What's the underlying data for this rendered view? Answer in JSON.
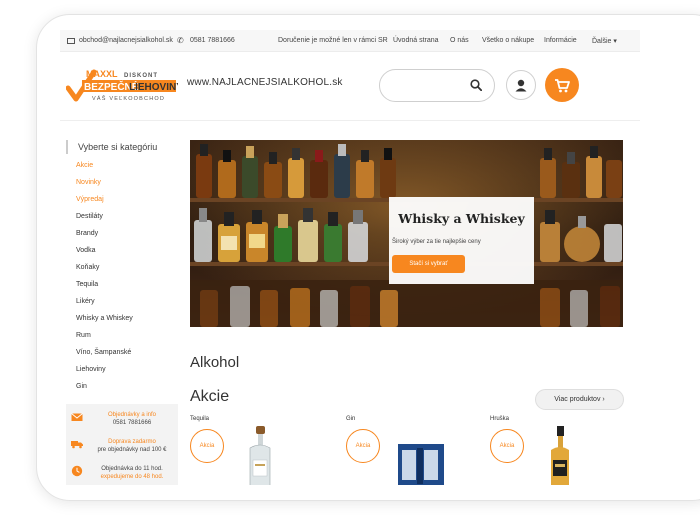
{
  "topbar": {
    "email": "obchod@najlacnejsialkohol.sk",
    "phone": "0581 7881666",
    "links": [
      "Doručenie je možné len v rámci SR",
      "Úvodná strana",
      "O nás",
      "Všetko o nákupe",
      "Informácie",
      "Ďalšie"
    ]
  },
  "logo": {
    "maxxl": "MAXXL",
    "diskont": "DISKONT",
    "bezpecne": "BEZPEČNÉ",
    "liehoviny": "LIEHOVINY",
    "tagline": "VÁŠ VEĽKOOBCHOD"
  },
  "header": {
    "domain": "www.NAJLACNEJSIALKOHOL.sk",
    "search_placeholder": ""
  },
  "sidebar": {
    "title": "Vyberte si kategóriu",
    "items": [
      {
        "label": "Akcie"
      },
      {
        "label": "Novinky"
      },
      {
        "label": "Výpredaj"
      },
      {
        "label": "Destiláty"
      },
      {
        "label": "Brandy"
      },
      {
        "label": "Vodka"
      },
      {
        "label": "Koňaky"
      },
      {
        "label": "Tequila"
      },
      {
        "label": "Likéry"
      },
      {
        "label": "Whisky a Whiskey"
      },
      {
        "label": "Rum"
      },
      {
        "label": "Víno, Šampanské"
      },
      {
        "label": "Liehoviny"
      },
      {
        "label": "Gin"
      }
    ]
  },
  "info": {
    "orders_line1": "Objednávky a info",
    "orders_line2": "0581 7881666",
    "shipping_line1": "Doprava zadarmo",
    "shipping_line2": "pre objednávky nad 100 €",
    "time_line1": "Objednávka do 11 hod.",
    "time_line2": "expedujeme do 48 hod."
  },
  "banner": {
    "title": "Whisky a Whiskey",
    "subtitle": "Široký výber za tie najlepšie ceny",
    "button": "Stačí si vybrať"
  },
  "main": {
    "section_title": "Alkohol",
    "akcie_title": "Akcie",
    "more_button": "Viac produktov ›"
  },
  "products": [
    {
      "category": "Tequila",
      "badge": "Akcia"
    },
    {
      "category": "Gin",
      "badge": "Akcia"
    },
    {
      "category": "Hruška",
      "badge": "Akcia"
    }
  ],
  "colors": {
    "accent": "#f7871f",
    "text": "#333333",
    "topbar_bg": "#f7f7f7"
  }
}
